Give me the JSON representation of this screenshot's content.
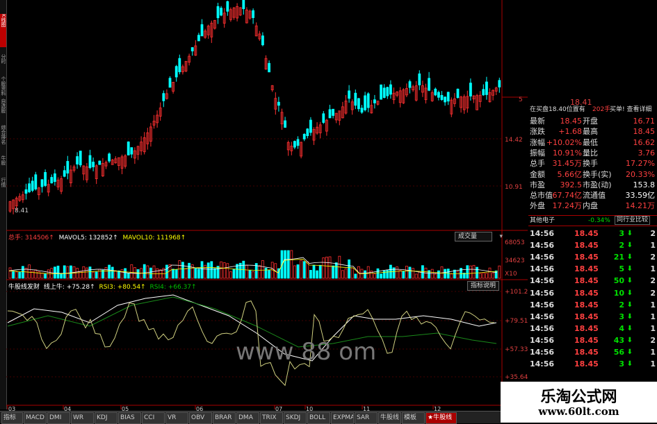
{
  "left_tabs": [
    "K线图",
    "分时",
    "个股资料",
    "自选股",
    "综合排名",
    "牛股",
    "行情"
  ],
  "left_active": 0,
  "price_axis": [
    "14.42",
    "10.91"
  ],
  "low_label": "8.41",
  "top_left_price": "5",
  "top_price_label": "18.41",
  "volume_bar": {
    "title": "总手: 314506↑",
    "ma5": "MAVOL5: 132852↑",
    "ma10": "MAVOL10: 111968↑",
    "button": "成交量",
    "axis": [
      "68053",
      "34623",
      "X10"
    ]
  },
  "indicator_bar": {
    "name": "牛股线发财",
    "line": "线上牛: +75.28↑",
    "rsi3": "RSI3: +80.54↑",
    "rsi4": "RSI4: +66.37↑",
    "button": "指标说明",
    "axis": [
      "+101.2",
      "+79.51",
      "+57.33",
      "+35.64"
    ]
  },
  "date_axis": [
    "03",
    "04",
    "05",
    "06",
    "07",
    "10",
    "11",
    "12"
  ],
  "panel": {
    "bid_info": "在买盘18.40位置有",
    "bid_qty": "202手",
    "bid_tail": "买单! 查看详细",
    "quotes": [
      {
        "l1": "最新",
        "v1": "18.45",
        "l2": "开盘",
        "v2": "16.71"
      },
      {
        "l1": "涨跌",
        "v1": "+1.68",
        "l2": "最高",
        "v2": "18.45"
      },
      {
        "l1": "涨幅",
        "v1": "+10.02%",
        "l2": "最低",
        "v2": "16.62"
      },
      {
        "l1": "振幅",
        "v1": "10.91%",
        "l2": "量比",
        "v2": "3.76"
      },
      {
        "l1": "总手",
        "v1": "31.45万",
        "l2": "换手",
        "v2": "17.27%"
      },
      {
        "l1": "金额",
        "v1": "5.66亿",
        "l2": "换手(实)",
        "v2": "20.33%"
      },
      {
        "l1": "市盈",
        "v1": "392.5",
        "l2": "市盈(动)",
        "v2": "153.8"
      },
      {
        "l1": "总市值",
        "v1": "67.74亿",
        "l2": "流通值",
        "v2": "33.59亿"
      },
      {
        "l1": "外盘",
        "v1": "17.24万",
        "l2": "内盘",
        "v2": "14.21万"
      }
    ],
    "sector": "其他电子",
    "sector_change": "-0.34%",
    "compare_btn": "同行业比较",
    "ticks": [
      {
        "time": "14:56",
        "price": "18.45",
        "vol": "3",
        "n": "2"
      },
      {
        "time": "14:56",
        "price": "18.45",
        "vol": "2",
        "n": "1"
      },
      {
        "time": "14:56",
        "price": "18.45",
        "vol": "21",
        "n": "2"
      },
      {
        "time": "14:56",
        "price": "18.45",
        "vol": "5",
        "n": "1"
      },
      {
        "time": "14:56",
        "price": "18.45",
        "vol": "50",
        "n": "2"
      },
      {
        "time": "14:56",
        "price": "18.45",
        "vol": "10",
        "n": "2"
      },
      {
        "time": "14:56",
        "price": "18.45",
        "vol": "2",
        "n": "1"
      },
      {
        "time": "14:56",
        "price": "18.45",
        "vol": "3",
        "n": "1"
      },
      {
        "time": "14:56",
        "price": "18.45",
        "vol": "4",
        "n": "1"
      },
      {
        "time": "14:56",
        "price": "18.45",
        "vol": "43",
        "n": "2"
      },
      {
        "time": "14:56",
        "price": "18.45",
        "vol": "56",
        "n": "1"
      },
      {
        "time": "14:56",
        "price": "18.45",
        "vol": "3",
        "n": "1"
      }
    ]
  },
  "bottom_tabs": [
    "指标",
    "MACD",
    "DMI",
    "WR",
    "KDJ",
    "BIAS",
    "CCI",
    "VR",
    "OBV",
    "BRAR",
    "DMA",
    "TRIX",
    "SKDJ",
    "BOLL",
    "EXPMA",
    "SAR",
    "牛股线",
    "模板",
    "★牛股线"
  ],
  "bottom_active": 18,
  "watermark": {
    "title": "乐淘公式网",
    "url": "www.60lt.com"
  },
  "chart_overlay": "www 88 om",
  "colors": {
    "up": "#ff3030",
    "down": "#00ffff",
    "yellow": "#ffff00",
    "green": "#00e000",
    "price_red": "#ff3030"
  }
}
